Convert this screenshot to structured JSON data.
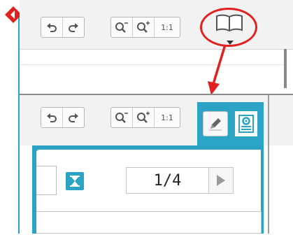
{
  "colors": {
    "accent": "#2aa3c4",
    "highlight": "#e32020",
    "toolbar_bg": "#f2f2f2"
  },
  "top_toolbar": {
    "undo_icon": "undo-arrow",
    "redo_icon": "redo-arrow",
    "zoom_out_icon": "zoom-out-magnifier",
    "zoom_in_icon": "zoom-in-magnifier",
    "zoom_reset_label": "1:1",
    "book_icon": "open-book",
    "dropdown_icon": "triangle-down"
  },
  "bottom_toolbar": {
    "undo_icon": "undo-arrow",
    "redo_icon": "redo-arrow",
    "zoom_out_icon": "zoom-out-magnifier",
    "zoom_in_icon": "zoom-in-magnifier",
    "zoom_reset_label": "1:1",
    "pencil_icon": "pencil",
    "document_icon": "document-view"
  },
  "panel": {
    "hourglass_icon": "hourglass",
    "page_indicator": "1/4",
    "next_icon": "play-right"
  }
}
